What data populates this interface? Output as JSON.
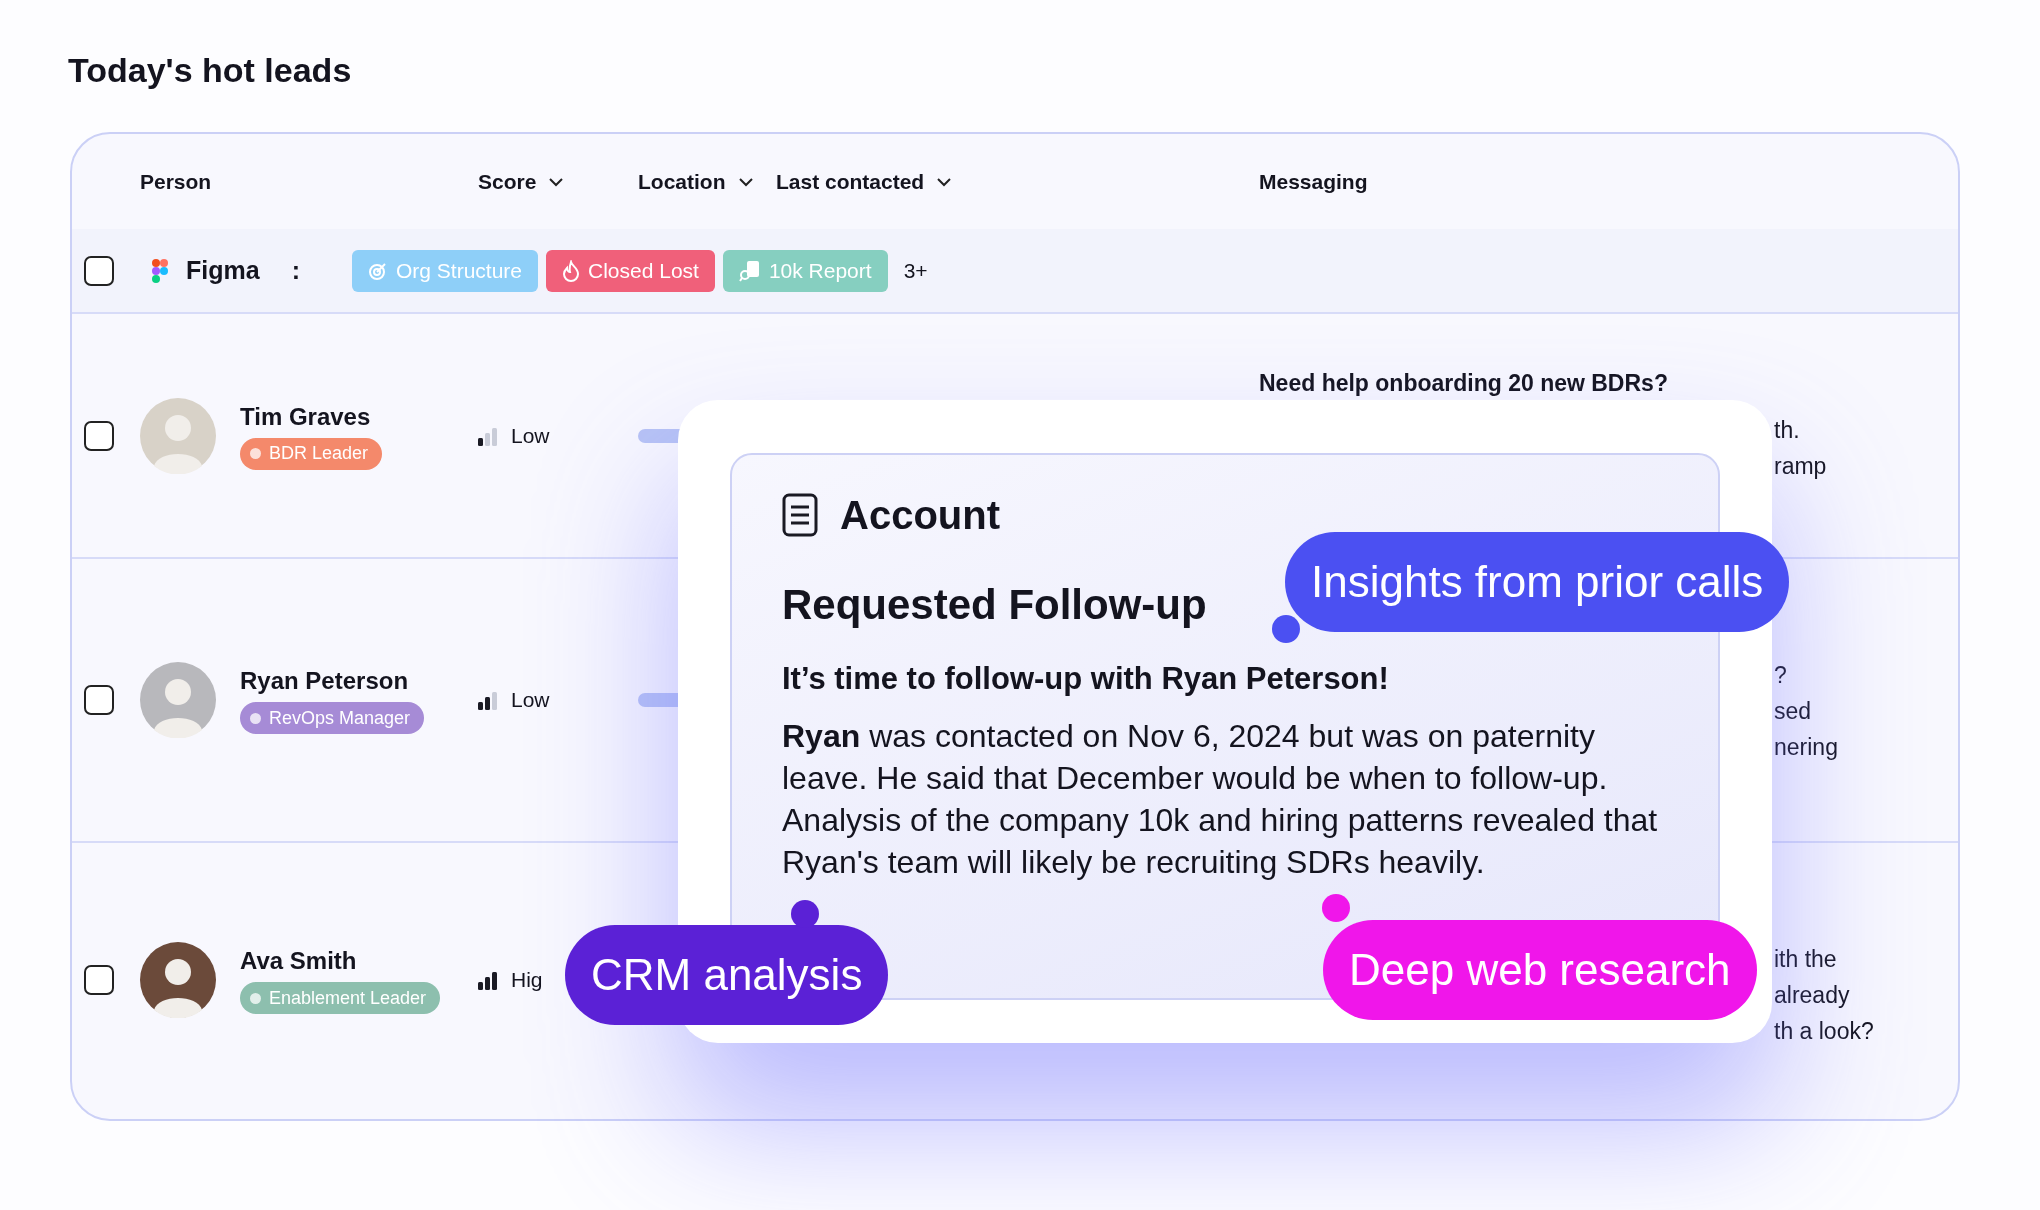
{
  "title": "Today's hot leads",
  "columns": [
    {
      "label": "Person",
      "sort_menu": false
    },
    {
      "label": "Score",
      "sort_menu": true
    },
    {
      "label": "Location",
      "sort_menu": true
    },
    {
      "label": "Last contacted",
      "sort_menu": true
    },
    {
      "label": "Messaging",
      "sort_menu": false
    }
  ],
  "group": {
    "checked": false,
    "company": "Figma",
    "menu": ":",
    "more": "3+",
    "tags": [
      {
        "kind": "target",
        "label": "Org Structure",
        "color": "#8ecff8"
      },
      {
        "kind": "flame",
        "label": "Closed Lost",
        "color": "#f0607a"
      },
      {
        "kind": "report",
        "label": "10k Report",
        "color": "#86cfc0"
      }
    ]
  },
  "rows": [
    {
      "checked": false,
      "name": "Tim Graves",
      "role": {
        "label": "BDR Leader",
        "color": "#f4896b"
      },
      "score": {
        "label": "Low",
        "level": 0.33
      },
      "progress_stub": true,
      "messaging": [
        {
          "kind": "headline",
          "text": "Need help onboarding 20 new BDRs?"
        },
        {
          "kind": "fragment",
          "text": "th."
        },
        {
          "kind": "fragment",
          "text": "ramp"
        }
      ]
    },
    {
      "checked": false,
      "name": "Ryan Peterson",
      "role": {
        "label": "RevOps Manager",
        "color": "#a68bd6"
      },
      "score": {
        "label": "Low",
        "level": 0.67
      },
      "progress_stub": true,
      "messaging": [
        {
          "kind": "fragment",
          "text": "?"
        },
        {
          "kind": "fragment",
          "text": "sed"
        },
        {
          "kind": "fragment",
          "text": "nering"
        }
      ]
    },
    {
      "checked": false,
      "name": "Ava Smith",
      "role": {
        "label": "Enablement Leader",
        "color": "#8dbfae"
      },
      "score": {
        "label": "Hig",
        "level": 1
      },
      "progress_stub": false,
      "messaging": [
        {
          "kind": "fragment",
          "text": "ith the"
        },
        {
          "kind": "fragment",
          "text": "already"
        },
        {
          "kind": "fragment",
          "text": "th a look?"
        }
      ]
    }
  ],
  "account_card": {
    "heading": "Account",
    "title": "Requested Follow-up",
    "subtitle": "It’s time to follow-up with Ryan Peterson!",
    "body": "**Ryan** was contacted on Nov 6, 2024 but was on paternity leave. He said that December would be when to follow-up. Analysis of the company 10k and hiring patterns revealed that Ryan's team will likely be recruiting SDRs heavily."
  },
  "callouts": [
    {
      "label": "Insights from prior calls",
      "color": "#4b50f2"
    },
    {
      "label": "CRM analysis",
      "color": "#5b21d6"
    },
    {
      "label": "Deep web research",
      "color": "#f016ea"
    }
  ]
}
